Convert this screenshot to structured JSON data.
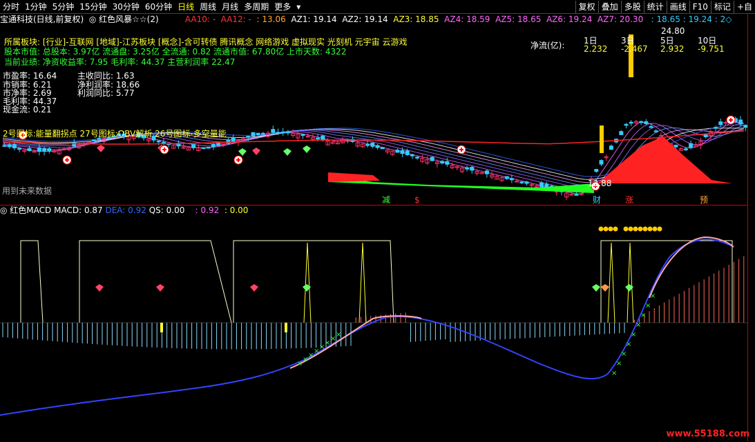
{
  "toolbar": {
    "periods": [
      "分时",
      "1分钟",
      "5分钟",
      "15分钟",
      "30分钟",
      "60分钟",
      "日线",
      "周线",
      "月线",
      "多周期",
      "更多"
    ],
    "active_period": "日线",
    "right_buttons": [
      "复权",
      "叠加",
      "多股",
      "统计",
      "画线",
      "F10",
      "标记",
      "+自"
    ]
  },
  "header": {
    "stock_title": "宝通科技(日线,前复权)",
    "indicator_name": "红色风暴☆☆(2)",
    "aa10": "AA10: -",
    "aa12": "AA12: -",
    "v1": ": 13.06",
    "az1": "AZ1: 19.14",
    "az2": "AZ2: 19.14",
    "az3": "AZ3: 18.85",
    "az4": "AZ4: 18.59",
    "az5": "AZ5: 18.65",
    "az6": "AZ6: 19.24",
    "az7": "AZ7: 20.30",
    "tail": ": 18.65 : 19.24 : 2◇"
  },
  "info": {
    "sector": "所属板块: [行业]-互联网 [地域]-江苏板块 [概念]-含可转债 腾讯概念 网络游戏 虚拟现实 光刻机 元宇宙 云游戏",
    "capital": "股本市值: 总股本: 3.97亿 流通盘: 3.25亿 全流通: 0.82 流通市值: 67.80亿 上市天数: 4322",
    "performance": "当前业绩: 净资收益率: 7.95 毛利率: 44.37 主营利润率 22.47",
    "left_metrics": [
      "市盈率: 16.64",
      "市销率: 6.21",
      "市净率: 2.69",
      "毛利率: 44.37",
      "现金流: 0.21"
    ],
    "right_metrics": [
      "主收同比: 1.63",
      "净利润率: 18.66",
      "利润同比: 5.77"
    ],
    "net_flow_label": "净流(亿):",
    "flow_periods": [
      "1日",
      "3日",
      "5日",
      "10日"
    ],
    "flow_values": [
      "2.232",
      "-2.467",
      "2.932",
      "-9.751"
    ],
    "overlay_text": "2号图标:能量翻拐点 27号图标:OBV解析 26号图标-多空量能",
    "peak_price": "24.80",
    "low_price": "12.88",
    "future_note": "用到未来数据",
    "bottom_signals": [
      "减",
      "$",
      "财",
      "涨",
      "预"
    ]
  },
  "macd": {
    "name": "红色MACD",
    "macd": "MACD: 0.87",
    "dea": "DEA: 0.92",
    "qs": "QS: 0.00",
    "v1": ": 0.92",
    "v2": ": 0.00"
  },
  "colors": {
    "up": "#ff3366",
    "down": "#33ccff",
    "ma_red": "#ff2222",
    "flow_green": "#22ff22",
    "flow_red": "#ff2222"
  },
  "watermark": "www.55188.com"
}
